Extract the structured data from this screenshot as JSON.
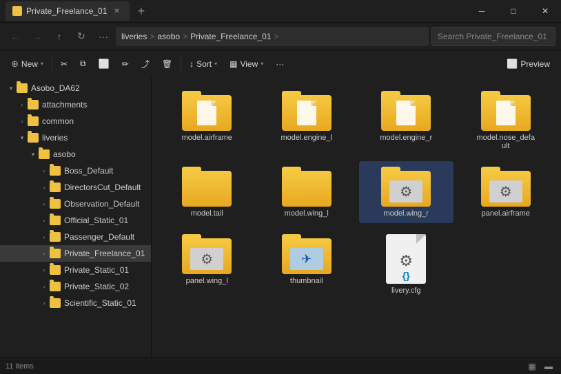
{
  "titlebar": {
    "tab_label": "Private_Freelance_01",
    "new_tab": "+",
    "minimize": "─",
    "maximize": "□",
    "close": "✕"
  },
  "addressbar": {
    "nav_back": "←",
    "nav_forward": "→",
    "nav_up": "↑",
    "nav_refresh": "↻",
    "nav_more": "···",
    "breadcrumbs": [
      "liveries",
      "asobo",
      "Private_Freelance_01"
    ],
    "breadcrumb_chevron": ">",
    "search_placeholder": "Search Private_Freelance_01"
  },
  "toolbar": {
    "new_label": "New",
    "new_chevron": "▾",
    "cut_icon": "✂",
    "copy_icon": "⧉",
    "paste_icon": "📋",
    "rename_icon": "✏",
    "share_icon": "⤴",
    "delete_icon": "🗑",
    "sort_label": "Sort",
    "sort_chevron": "▾",
    "view_label": "View",
    "view_chevron": "▾",
    "more_icon": "···",
    "preview_icon": "⬜",
    "preview_label": "Preview"
  },
  "sidebar": {
    "items": [
      {
        "label": "Asobo_DA62",
        "level": 1,
        "expanded": true,
        "chevron": "▾"
      },
      {
        "label": "attachments",
        "level": 2,
        "expanded": false,
        "chevron": "›"
      },
      {
        "label": "common",
        "level": 2,
        "expanded": false,
        "chevron": "›"
      },
      {
        "label": "liveries",
        "level": 2,
        "expanded": true,
        "chevron": "▾"
      },
      {
        "label": "asobo",
        "level": 3,
        "expanded": true,
        "chevron": "▾"
      },
      {
        "label": "Boss_Default",
        "level": 4,
        "expanded": false,
        "chevron": "›"
      },
      {
        "label": "DirectorsCut_Default",
        "level": 4,
        "expanded": false,
        "chevron": "›"
      },
      {
        "label": "Observation_Default",
        "level": 4,
        "expanded": false,
        "chevron": "›"
      },
      {
        "label": "Official_Static_01",
        "level": 4,
        "expanded": false,
        "chevron": "›"
      },
      {
        "label": "Passenger_Default",
        "level": 4,
        "expanded": false,
        "chevron": "›"
      },
      {
        "label": "Private_Freelance_01",
        "level": 4,
        "expanded": false,
        "chevron": "›",
        "selected": true
      },
      {
        "label": "Private_Static_01",
        "level": 4,
        "expanded": false,
        "chevron": "›"
      },
      {
        "label": "Private_Static_02",
        "level": 4,
        "expanded": false,
        "chevron": "›"
      },
      {
        "label": "Scientific_Static_01",
        "level": 4,
        "expanded": false,
        "chevron": "›"
      }
    ]
  },
  "files": [
    {
      "name": "model.airframe",
      "type": "folder",
      "variant": "page"
    },
    {
      "name": "model.engine_l",
      "type": "folder",
      "variant": "page"
    },
    {
      "name": "model.engine_r",
      "type": "folder",
      "variant": "page"
    },
    {
      "name": "model.nose_default",
      "type": "folder",
      "variant": "page"
    },
    {
      "name": "model.tail",
      "type": "folder",
      "variant": "plain"
    },
    {
      "name": "model.wing_l",
      "type": "folder",
      "variant": "plain"
    },
    {
      "name": "model.wing_r",
      "type": "folder",
      "variant": "gear",
      "selected": true
    },
    {
      "name": "panel.airframe",
      "type": "folder",
      "variant": "gear"
    },
    {
      "name": "panel.wing_l",
      "type": "folder",
      "variant": "gear2"
    },
    {
      "name": "thumbnail",
      "type": "folder",
      "variant": "plane"
    },
    {
      "name": "livery.cfg",
      "type": "cfg"
    }
  ],
  "statusbar": {
    "count": "11 items",
    "view_grid": "▦",
    "view_list": "≡"
  }
}
